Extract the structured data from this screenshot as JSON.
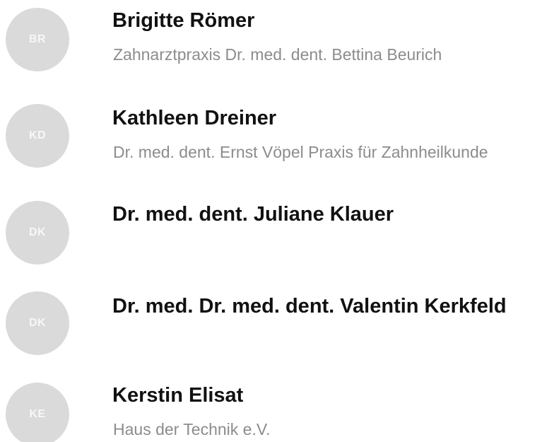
{
  "colors": {
    "avatar_background": "#dadada",
    "avatar_text": "#f7f7f7",
    "name_text": "#111111",
    "org_text": "#8c8c8c"
  },
  "contacts": [
    {
      "initials": "BR",
      "name": "Brigitte Römer",
      "organization": "Zahnarztpraxis Dr. med. dent. Bettina Beurich"
    },
    {
      "initials": "KD",
      "name": "Kathleen Dreiner",
      "organization": "Dr. med. dent. Ernst Vöpel Praxis für Zahnheilkunde"
    },
    {
      "initials": "DK",
      "name": "Dr. med. dent. Juliane Klauer",
      "organization": ""
    },
    {
      "initials": "DK",
      "name": "Dr. med. Dr. med. dent. Valentin Kerkfeld",
      "organization": ""
    },
    {
      "initials": "KE",
      "name": "Kerstin Elisat",
      "organization": "Haus der Technik e.V."
    }
  ]
}
